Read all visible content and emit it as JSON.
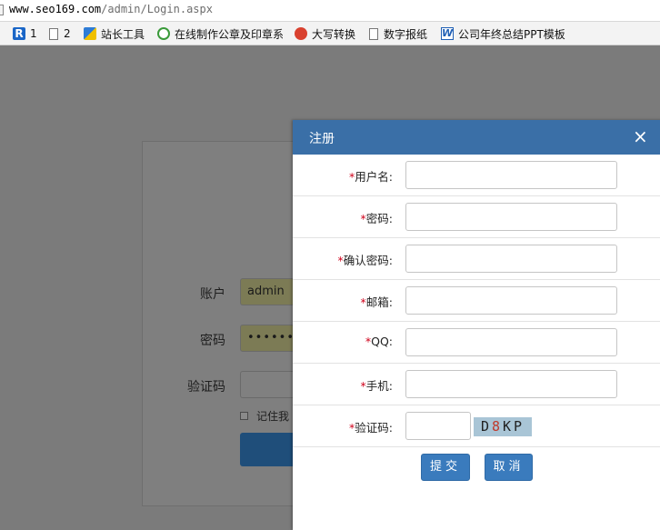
{
  "browser": {
    "address": {
      "host": "www.seo169.com",
      "path": "/admin/Login.aspx"
    },
    "bookmarks": [
      {
        "label": "1",
        "icon": "r-logo-icon"
      },
      {
        "label": "2",
        "icon": "page-icon"
      },
      {
        "label": "站长工具",
        "icon": "tool-icon"
      },
      {
        "label": "在线制作公章及印章系",
        "icon": "seal-icon"
      },
      {
        "label": "大写转换",
        "icon": "convert-icon"
      },
      {
        "label": "数字报纸",
        "icon": "page-icon"
      },
      {
        "label": "公司年终总结PPT模板",
        "icon": "word-icon"
      }
    ]
  },
  "login": {
    "account_label": "账户",
    "account_value": "admin",
    "password_label": "密码",
    "password_value": "••••••",
    "captcha_label": "验证码",
    "remember_label": "记住我"
  },
  "modal": {
    "title": "注册",
    "close": "×",
    "required_mark": "*",
    "fields": [
      {
        "label": "用户名:"
      },
      {
        "label": "密码:"
      },
      {
        "label": "确认密码:"
      },
      {
        "label": "邮箱:"
      },
      {
        "label": "QQ:"
      },
      {
        "label": "手机:"
      },
      {
        "label": "验证码:"
      }
    ],
    "captcha": {
      "c0": "D",
      "c1": "8",
      "c2": "KP"
    },
    "submit": "提交",
    "cancel": "取消"
  }
}
